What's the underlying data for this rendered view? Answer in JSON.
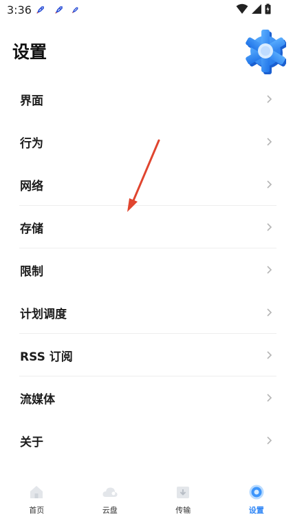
{
  "status_bar": {
    "time": "3:36"
  },
  "page": {
    "title": "设置"
  },
  "menu": {
    "items": [
      {
        "label": "界面"
      },
      {
        "label": "行为"
      },
      {
        "label": "网络"
      },
      {
        "label": "存储"
      },
      {
        "label": "限制"
      },
      {
        "label": "计划调度"
      },
      {
        "label": "RSS 订阅"
      },
      {
        "label": "流媒体"
      },
      {
        "label": "关于"
      }
    ]
  },
  "tabs": [
    {
      "label": "首页",
      "icon": "home-icon",
      "active": false
    },
    {
      "label": "云盘",
      "icon": "cloud-icon",
      "active": false
    },
    {
      "label": "传输",
      "icon": "transfer-icon",
      "active": false
    },
    {
      "label": "设置",
      "icon": "settings-icon",
      "active": true
    }
  ],
  "colors": {
    "accent": "#2f86f6",
    "annotation_arrow": "#e0452f",
    "divider": "#eeeeee"
  }
}
